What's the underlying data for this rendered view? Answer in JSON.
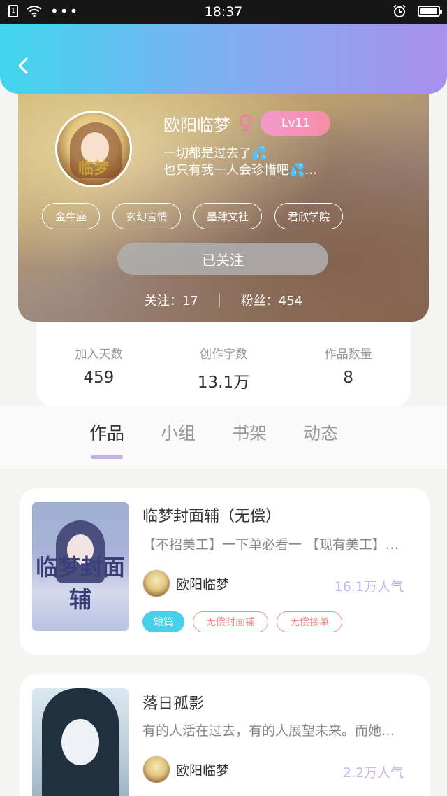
{
  "status_bar": {
    "time": "18:37",
    "sim_label": "1"
  },
  "profile": {
    "name": "欧阳临梦",
    "level": "Lv11",
    "bio_line1": "一切都是过去了💦",
    "bio_line2": "也只有我一人会珍惜吧💦…",
    "avatar_text": "临梦",
    "tags": [
      "金牛座",
      "玄幻言情",
      "墨肆文社",
      "君欣学院"
    ],
    "follow_button": "已关注",
    "following": "关注：17",
    "fans": "粉丝：454"
  },
  "stats": [
    {
      "label": "加入天数",
      "value": "459"
    },
    {
      "label": "创作字数",
      "value": "13.1万"
    },
    {
      "label": "作品数量",
      "value": "8"
    }
  ],
  "tabs": [
    "作品",
    "小组",
    "书架",
    "动态"
  ],
  "works": [
    {
      "title": "临梦封面辅（无偿）",
      "desc": "【不招美工】一下单必看一 【现有美工】…",
      "cover_text": "临梦封面辅",
      "author": "欧阳临梦",
      "popularity": "16.1万人气",
      "badges": [
        "短篇",
        "无偿封面铺",
        "无偿接单"
      ]
    },
    {
      "title": "落日孤影",
      "desc": "有的人活在过去，有的人展望未来。而她…",
      "author": "欧阳临梦",
      "popularity": "2.2万人气"
    }
  ],
  "colors": {
    "header_start": "#3fd6ee",
    "header_end": "#a98fee",
    "accent": "#c6b2ee",
    "tag_fill": "#46d1ea",
    "tag_outline": "#f0908b"
  }
}
